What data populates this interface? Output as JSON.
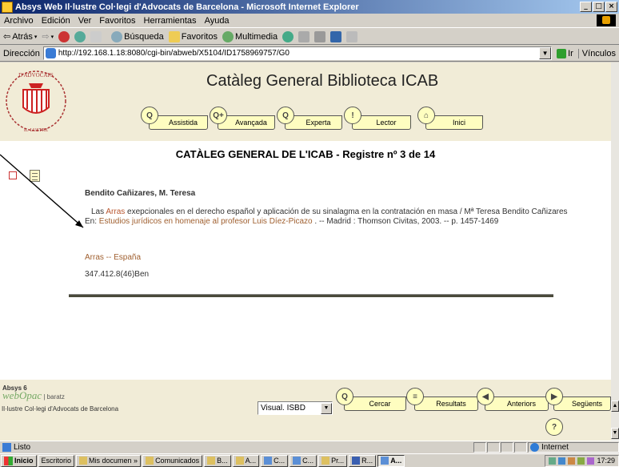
{
  "window": {
    "title": "Absys Web Il·lustre Col·legi d'Advocats de Barcelona - Microsoft Internet Explorer",
    "controls": [
      "_",
      "□",
      "×"
    ]
  },
  "menubar": {
    "items": [
      "Archivo",
      "Edición",
      "Ver",
      "Favoritos",
      "Herramientas",
      "Ayuda"
    ]
  },
  "toolbar": {
    "back": "Atrás",
    "search": "Búsqueda",
    "favorites": "Favoritos",
    "multimedia": "Multimedia"
  },
  "address": {
    "label": "Dirección",
    "url": "http://192.168.1.18:8080/cgi-bin/abweb/X5104/ID1758969757/G0",
    "go": "Ir",
    "links": "Vínculos"
  },
  "page": {
    "site_title": "Catàleg General Biblioteca ICAB",
    "nav": [
      {
        "label": "Assistida",
        "glyph": "Q"
      },
      {
        "label": "Avançada",
        "glyph": "Q+"
      },
      {
        "label": "Experta",
        "glyph": "Q"
      },
      {
        "label": "Lector",
        "glyph": "!"
      },
      {
        "label": "Inici",
        "glyph": "⌂"
      }
    ],
    "record_title": "CATÀLEG GENERAL DE L'ICAB - Registre nº 3 de 14",
    "author": "Bendito Cañizares, M. Teresa",
    "body": {
      "prefix": "Las ",
      "title_link": "Arras",
      "title_rest": " exepcionales en el derecho español y aplicación de su sinalagma en la contratación en masa / Mª Teresa Bendito Cañizares",
      "in_label": "En: ",
      "in_link": "Estudios jurídicos en homenaje al profesor Luis Díez-Picazo",
      "in_rest": " . -- Madrid : Thomson Civitas, 2003. -- p. 1457-1469"
    },
    "subject": "Arras -- España",
    "call_number": "347.412.8(46)Ben",
    "footer": {
      "absys_label": "Absys 6",
      "brand": "webOpac",
      "brand_suffix": "| baratz",
      "institution": "Il·lustre Col·legi d'Advocats de Barcelona",
      "view_select": "Visual. ISBD",
      "buttons": [
        {
          "label": "Cercar",
          "glyph": "Q"
        },
        {
          "label": "Resultats",
          "glyph": "≡"
        },
        {
          "label": "Anteriors",
          "glyph": "◀"
        },
        {
          "label": "Següents",
          "glyph": "▶"
        }
      ],
      "help_glyph": "?"
    }
  },
  "statusbar": {
    "text": "Listo",
    "zone": "Internet"
  },
  "taskbar": {
    "start": "Inicio",
    "items": [
      "Escritorio",
      "Mis documen »",
      "Comunicados",
      "B...",
      "A...",
      "C...",
      "C...",
      "Pr...",
      "R...",
      "A..."
    ],
    "clock": "17:29"
  }
}
